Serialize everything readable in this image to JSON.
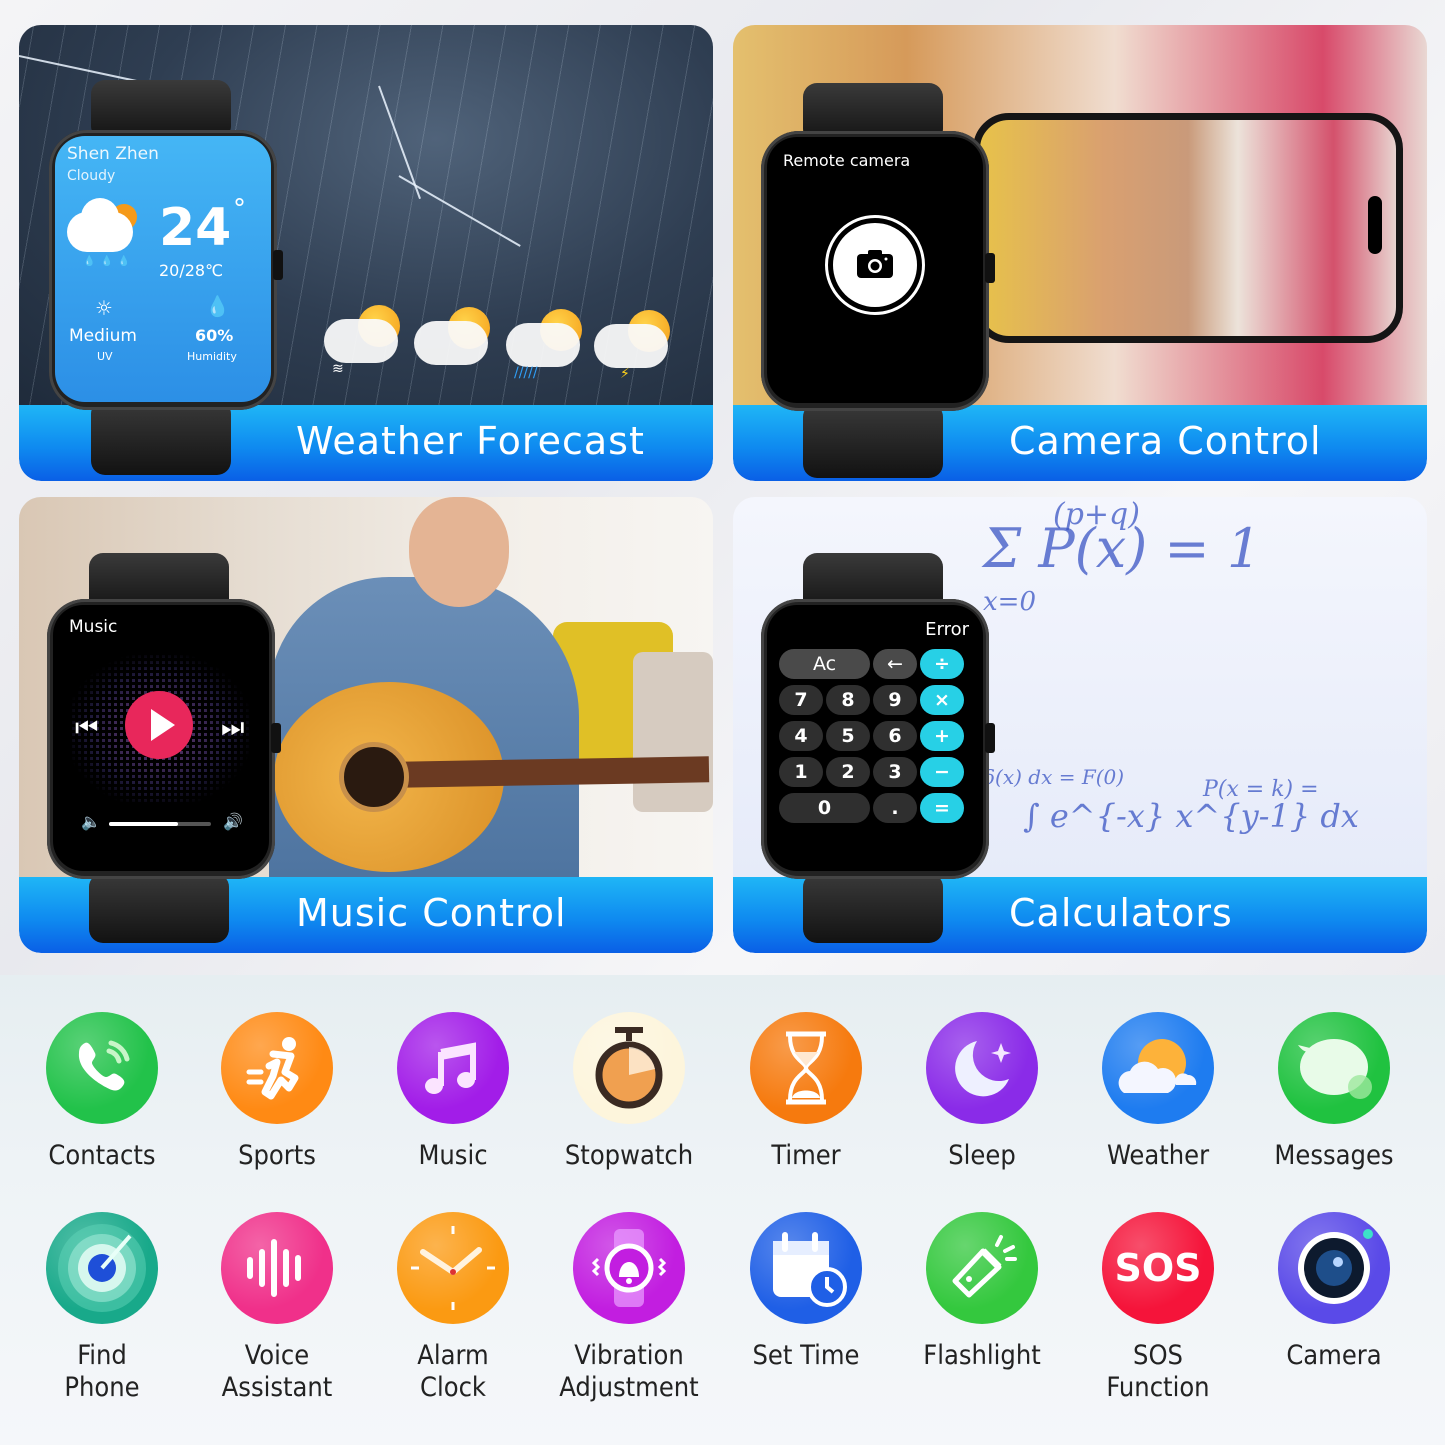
{
  "panels": [
    {
      "id": "weather",
      "title": "Weather Forecast",
      "watch_screen": {
        "city": "Shen Zhen",
        "condition": "Cloudy",
        "temperature": "24",
        "degree_symbol": "°",
        "range": "20/28℃",
        "uv_value": "Medium",
        "uv_label": "UV",
        "humidity_value": "60%",
        "humidity_label": "Humidity"
      },
      "forecast_icons": [
        "fog",
        "cloudy",
        "rain",
        "thunderstorm"
      ]
    },
    {
      "id": "camera",
      "title": "Camera Control",
      "watch_screen": {
        "title": "Remote camera",
        "shutter_icon": "camera-icon"
      }
    },
    {
      "id": "music",
      "title": "Music Control",
      "watch_screen": {
        "title": "Music",
        "volume_fraction": 0.68,
        "prev_glyph": "⏮",
        "next_glyph": "⏭",
        "play_glyph": "▶",
        "vol_low_glyph": "🔈",
        "vol_high_glyph": "🔊"
      }
    },
    {
      "id": "calculator",
      "title": "Calculators",
      "watch_screen": {
        "display": "Error",
        "keys": [
          "Ac",
          "←",
          "÷",
          "7",
          "8",
          "9",
          "×",
          "4",
          "5",
          "6",
          "+",
          "1",
          "2",
          "3",
          "−",
          "0",
          ".",
          "="
        ]
      },
      "background_formulas": [
        "Σ P(x) = 1",
        "x=0",
        "(p+q)",
        "∫ e^{-x} x^{y-1} dx",
        "δ(x) dx = F(0)",
        "P(x = k) ="
      ]
    }
  ],
  "apps": [
    {
      "label": "Contacts",
      "icon": "phone-icon",
      "color": "#22c24a"
    },
    {
      "label": "Sports",
      "icon": "running-icon",
      "color": "#ff8a14"
    },
    {
      "label": "Music",
      "icon": "music-note-icon",
      "color": "#a21de8"
    },
    {
      "label": "Stopwatch",
      "icon": "stopwatch-icon",
      "color": "#fdf5dc"
    },
    {
      "label": "Timer",
      "icon": "hourglass-icon",
      "color": "#f67a0e"
    },
    {
      "label": "Sleep",
      "icon": "moon-icon",
      "color": "#8a2be8"
    },
    {
      "label": "Weather",
      "icon": "sun-cloud-icon",
      "color": "#1e7cf0"
    },
    {
      "label": "Messages",
      "icon": "message-bubble-icon",
      "color": "#20c240"
    },
    {
      "label": "Find\nPhone",
      "line1": "Find",
      "line2": "Phone",
      "icon": "radar-icon",
      "color": "#18a98a"
    },
    {
      "label": "Voice\nAssistant",
      "line1": "Voice",
      "line2": "Assistant",
      "icon": "sound-wave-icon",
      "color": "#f0308a"
    },
    {
      "label": "Alarm\nClock",
      "line1": "Alarm",
      "line2": "Clock",
      "icon": "clock-icon",
      "color": "#fb9a12"
    },
    {
      "label": "Vibration\nAdjustment",
      "line1": "Vibration",
      "line2": "Adjustment",
      "icon": "bell-vibrate-icon",
      "color": "#c21ee0"
    },
    {
      "label": "Set Time",
      "icon": "calendar-clock-icon",
      "color": "#1f5fe6"
    },
    {
      "label": "Flashlight",
      "icon": "flashlight-icon",
      "color": "#34c83e"
    },
    {
      "label": "SOS\nFunction",
      "line1": "SOS",
      "line2": "Function",
      "icon": "sos-icon",
      "icon_text": "SOS",
      "color": "#f5143a"
    },
    {
      "label": "Camera",
      "icon": "camera-lens-icon",
      "color": "#5a4ae8"
    }
  ]
}
